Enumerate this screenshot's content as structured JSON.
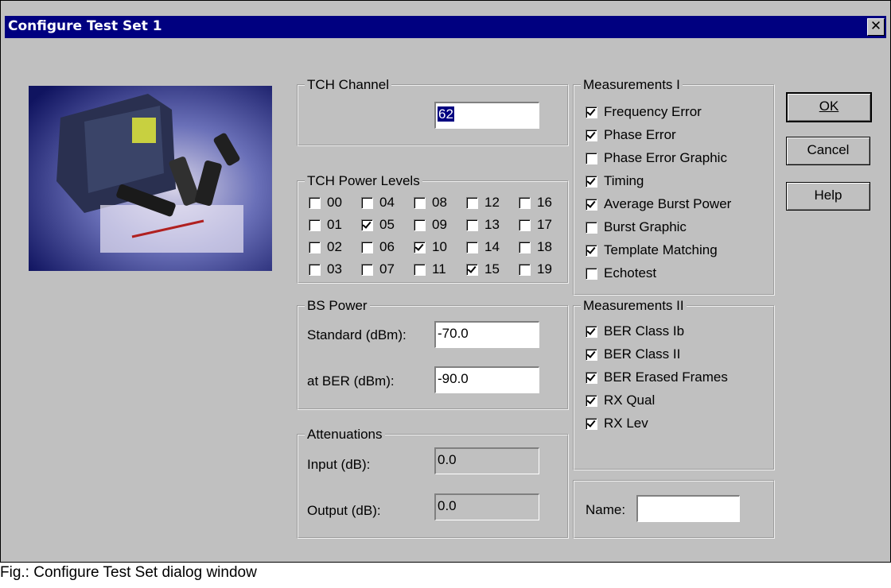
{
  "window": {
    "title": "Configure Test Set 1",
    "close_glyph": "✕"
  },
  "tch_channel": {
    "legend": "TCH Channel",
    "value": "62"
  },
  "power_levels": {
    "legend": "TCH Power Levels",
    "rows": [
      [
        {
          "label": "00",
          "checked": false
        },
        {
          "label": "04",
          "checked": false
        },
        {
          "label": "08",
          "checked": false
        },
        {
          "label": "12",
          "checked": false
        },
        {
          "label": "16",
          "checked": false
        }
      ],
      [
        {
          "label": "01",
          "checked": false
        },
        {
          "label": "05",
          "checked": true
        },
        {
          "label": "09",
          "checked": false
        },
        {
          "label": "13",
          "checked": false
        },
        {
          "label": "17",
          "checked": false
        }
      ],
      [
        {
          "label": "02",
          "checked": false
        },
        {
          "label": "06",
          "checked": false
        },
        {
          "label": "10",
          "checked": true
        },
        {
          "label": "14",
          "checked": false
        },
        {
          "label": "18",
          "checked": false
        }
      ],
      [
        {
          "label": "03",
          "checked": false
        },
        {
          "label": "07",
          "checked": false
        },
        {
          "label": "11",
          "checked": false
        },
        {
          "label": "15",
          "checked": true
        },
        {
          "label": "19",
          "checked": false
        }
      ]
    ]
  },
  "bs_power": {
    "legend": "BS Power",
    "standard_label": "Standard (dBm):",
    "standard_value": "-70.0",
    "ber_label": "at BER (dBm):",
    "ber_value": "-90.0"
  },
  "attenuations": {
    "legend": "Attenuations",
    "input_label": "Input (dB):",
    "input_value": "0.0",
    "output_label": "Output (dB):",
    "output_value": "0.0"
  },
  "measurements1": {
    "legend": "Measurements I",
    "items": [
      {
        "label": "Frequency Error",
        "checked": true
      },
      {
        "label": "Phase Error",
        "checked": true
      },
      {
        "label": "Phase Error Graphic",
        "checked": false
      },
      {
        "label": "Timing",
        "checked": true
      },
      {
        "label": "Average Burst Power",
        "checked": true
      },
      {
        "label": "Burst Graphic",
        "checked": false
      },
      {
        "label": "Template Matching",
        "checked": true
      },
      {
        "label": "Echotest",
        "checked": false
      }
    ]
  },
  "measurements2": {
    "legend": "Measurements II",
    "items": [
      {
        "label": "BER Class Ib",
        "checked": true
      },
      {
        "label": "BER Class II",
        "checked": true
      },
      {
        "label": "BER Erased Frames",
        "checked": true
      },
      {
        "label": "RX Qual",
        "checked": true
      },
      {
        "label": "RX Lev",
        "checked": true
      }
    ]
  },
  "name_field": {
    "label": "Name:",
    "value": ""
  },
  "buttons": {
    "ok": "OK",
    "cancel": "Cancel",
    "help": "Help"
  },
  "caption": "Fig.: Configure Test Set dialog window"
}
